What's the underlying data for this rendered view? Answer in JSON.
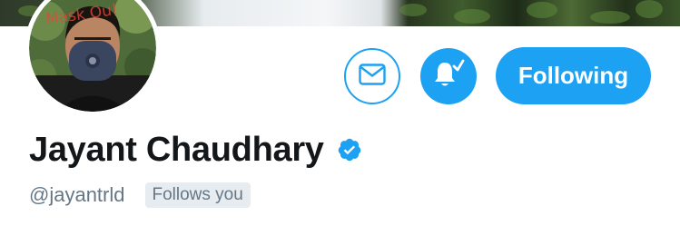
{
  "profile": {
    "display_name": "Jayant Chaudhary",
    "handle": "@jayantrld",
    "follows_you_badge": "Follows you",
    "verified": true,
    "avatar_overlay_text": "Mask Ou!"
  },
  "actions": {
    "message_icon": "envelope-icon",
    "notifications_icon": "bell-check-icon",
    "following_label": "Following"
  },
  "colors": {
    "accent": "#1da1f2",
    "name_text": "#14171a",
    "secondary_text": "#657786",
    "badge_bg": "#e6ecf0"
  }
}
